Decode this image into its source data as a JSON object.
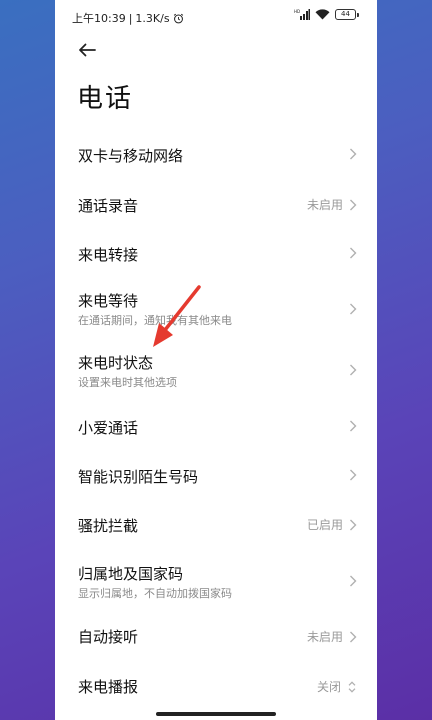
{
  "status_bar": {
    "time": "上午10:39",
    "separator": "|",
    "speed": "1.3K/s",
    "battery": "44"
  },
  "page": {
    "title": "电话"
  },
  "settings": [
    {
      "label": "双卡与移动网络",
      "status": "",
      "subtitle": ""
    },
    {
      "label": "通话录音",
      "status": "未启用",
      "subtitle": ""
    },
    {
      "label": "来电转接",
      "status": "",
      "subtitle": ""
    },
    {
      "label": "来电等待",
      "status": "",
      "subtitle": "在通话期间，通知我有其他来电"
    },
    {
      "label": "来电时状态",
      "status": "",
      "subtitle": "设置来电时其他选项"
    },
    {
      "label": "小爱通话",
      "status": "",
      "subtitle": ""
    },
    {
      "label": "智能识别陌生号码",
      "status": "",
      "subtitle": ""
    },
    {
      "label": "骚扰拦截",
      "status": "已启用",
      "subtitle": ""
    },
    {
      "label": "归属地及国家码",
      "status": "",
      "subtitle": "显示归属地，不自动加拨国家码"
    },
    {
      "label": "自动接听",
      "status": "未启用",
      "subtitle": ""
    },
    {
      "label": "来电播报",
      "status": "关闭",
      "subtitle": ""
    }
  ],
  "colors": {
    "annotation_arrow": "#e53a2f",
    "background_gradient_start": "#3a6fc0",
    "background_gradient_end": "#5b2fa6"
  }
}
